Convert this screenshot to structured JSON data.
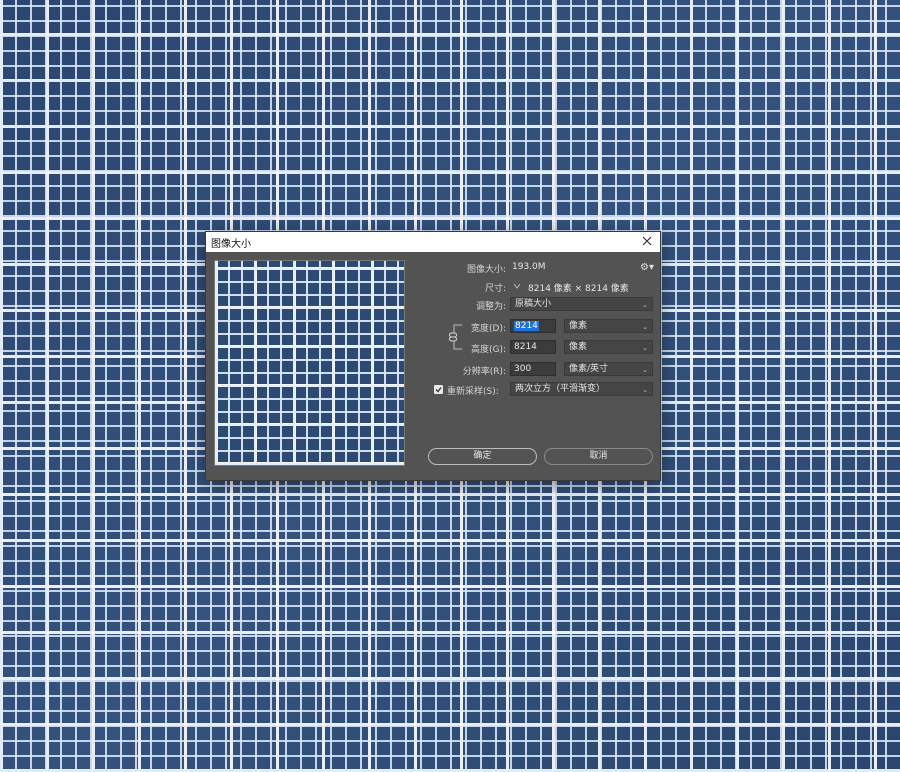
{
  "dialog": {
    "title": "图像大小",
    "image_size_label": "图像大小:",
    "image_size_value": "193.0M",
    "dimensions_label": "尺寸:",
    "dimensions_value": "8214 像素 × 8214 像素",
    "fit_to_label": "调整为:",
    "fit_to_value": "原稿大小",
    "width_label": "宽度(D):",
    "width_value": "8214",
    "width_unit": "像素",
    "height_label": "高度(G):",
    "height_value": "8214",
    "height_unit": "像素",
    "resolution_label": "分辨率(R):",
    "resolution_value": "300",
    "resolution_unit": "像素/英寸",
    "resample_label": "重新采样(S):",
    "resample_checked": true,
    "resample_value": "两次立方（平滑渐变）",
    "ok_label": "确定",
    "cancel_label": "取消"
  },
  "icons": [
    "close-icon",
    "gear-icon",
    "chevron-down-icon",
    "link-icon",
    "checkbox-icon"
  ],
  "colors": {
    "dialog_bg": "#535353",
    "field_bg": "#3c3c3c",
    "selection": "#1f72d9",
    "background_pattern": "#2d4a72"
  }
}
